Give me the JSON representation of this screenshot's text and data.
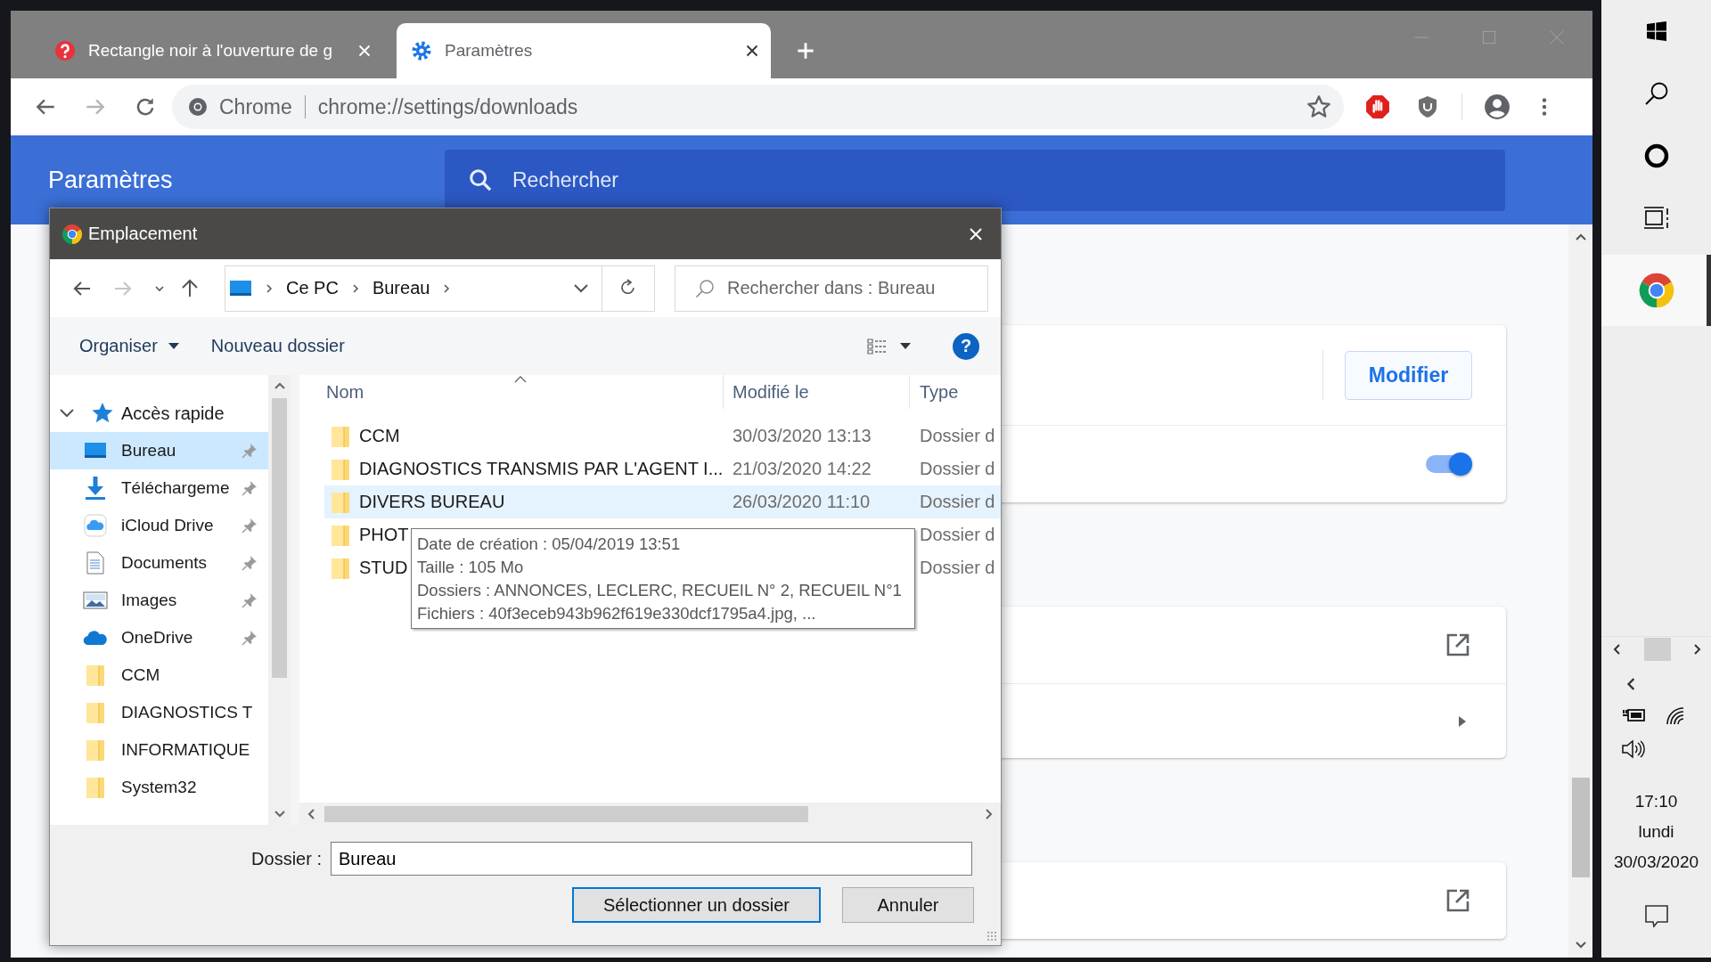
{
  "browser": {
    "tabs": [
      {
        "title": "Rectangle noir à l'ouverture de g",
        "kind": "help",
        "selected": false
      },
      {
        "title": "Paramètres",
        "kind": "gear",
        "selected": true
      }
    ],
    "omnibox": {
      "label": "Chrome",
      "url": "chrome://settings/downloads"
    }
  },
  "settings": {
    "title": "Paramètres",
    "search": {
      "placeholder": "Rechercher"
    },
    "cards": [
      {
        "rows": [
          {
            "kind": "button",
            "button": "Modifier"
          },
          {
            "kind": "toggle",
            "on": true
          }
        ]
      },
      {
        "rows": [
          {
            "kind": "external"
          },
          {
            "kind": "submenu"
          }
        ]
      },
      {
        "rows": [
          {
            "kind": "external"
          }
        ]
      }
    ]
  },
  "dialog": {
    "title": "Emplacement",
    "breadcrumb": [
      "Ce PC",
      "Bureau"
    ],
    "search": {
      "placeholder": "Rechercher dans : Bureau"
    },
    "commands": [
      "Organiser",
      "Nouveau dossier"
    ],
    "help": "?",
    "nav_pane": {
      "label": "Accès rapide",
      "expanded": true,
      "children": [
        {
          "label": "Bureau",
          "kind": "desktop",
          "pinned": true,
          "selected": true
        },
        {
          "label": "Téléchargeme",
          "kind": "download",
          "pinned": true,
          "selected": false
        },
        {
          "label": "iCloud Drive",
          "kind": "icloud",
          "pinned": true,
          "selected": false
        },
        {
          "label": "Documents",
          "kind": "documents",
          "pinned": true,
          "selected": false
        },
        {
          "label": "Images",
          "kind": "images",
          "pinned": true,
          "selected": false
        },
        {
          "label": "OneDrive",
          "kind": "onedrive",
          "pinned": true,
          "selected": false
        },
        {
          "label": "CCM",
          "kind": "folder",
          "pinned": false,
          "selected": false
        },
        {
          "label": "DIAGNOSTICS T",
          "kind": "folder",
          "pinned": false,
          "selected": false
        },
        {
          "label": "INFORMATIQUE",
          "kind": "folder",
          "pinned": false,
          "selected": false
        },
        {
          "label": "System32",
          "kind": "folder",
          "pinned": false,
          "selected": false
        }
      ]
    },
    "columns": [
      "Nom",
      "Modifié le",
      "Type"
    ],
    "rows": [
      {
        "name": "CCM",
        "modified": "30/03/2020 13:13",
        "type": "Dossier d",
        "highlighted": false
      },
      {
        "name": "DIAGNOSTICS TRANSMIS PAR L'AGENT I...",
        "modified": "21/03/2020 14:22",
        "type": "Dossier d",
        "highlighted": false
      },
      {
        "name": "DIVERS BUREAU",
        "modified": "26/03/2020 11:10",
        "type": "Dossier d",
        "highlighted": true
      },
      {
        "name": "PHOT",
        "type": "Dossier d",
        "highlighted": false
      },
      {
        "name": "STUD",
        "type": "Dossier d",
        "highlighted": false
      }
    ],
    "tooltip": [
      "Date de création : 05/04/2019 13:51",
      "Taille : 105 Mo",
      "Dossiers : ANNONCES, LECLERC, RECUEIL N° 2, RECUEIL N°1",
      "Fichiers : 40f3eceb943b962f619e330dcf1795a4.jpg, ..."
    ],
    "folder_field": {
      "label": "Dossier :",
      "value": "Bureau"
    },
    "buttons": [
      {
        "label": "Sélectionner un dossier",
        "default": true
      },
      {
        "label": "Annuler",
        "default": false
      }
    ]
  },
  "taskbar": {
    "apps": [
      {
        "kind": "start",
        "active": false
      },
      {
        "kind": "search",
        "active": false
      },
      {
        "kind": "cortana",
        "active": false
      },
      {
        "kind": "taskview",
        "active": false
      },
      {
        "kind": "chrome",
        "active": true
      }
    ],
    "clock": {
      "time": "17:10",
      "day": "lundi",
      "date": "30/03/2020"
    }
  }
}
